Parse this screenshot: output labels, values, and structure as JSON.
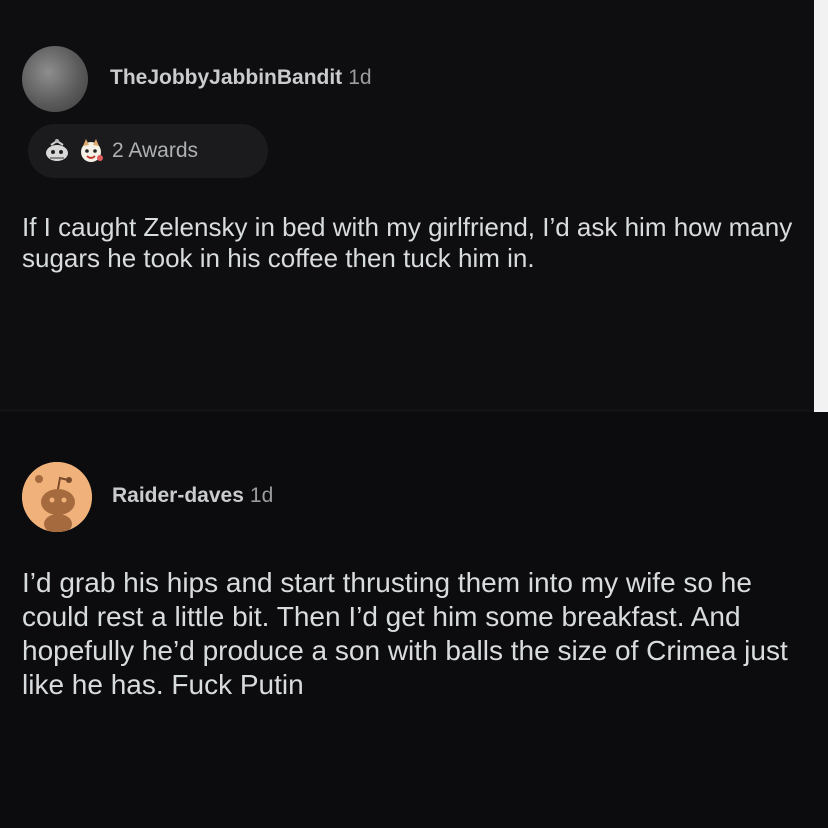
{
  "comments": [
    {
      "username": "TheJobbyJabbinBandit",
      "age": "1d",
      "awards_label": "2 Awards",
      "awards": [
        "silver-award-icon",
        "wholesome-award-icon"
      ],
      "body": "If I caught Zelensky in bed with my girlfriend, I’d ask him how many sugars he took in his coffee then tuck him in."
    },
    {
      "username": "Raider-daves",
      "age": "1d",
      "avatar_color": "#f0b27a",
      "body": "I’d grab his hips and start thrusting them into my wife so he could rest a little bit. Then I’d get him some breakfast. And hopefully he’d produce a son with balls the size of Crimea just like he has. Fuck Putin"
    }
  ]
}
